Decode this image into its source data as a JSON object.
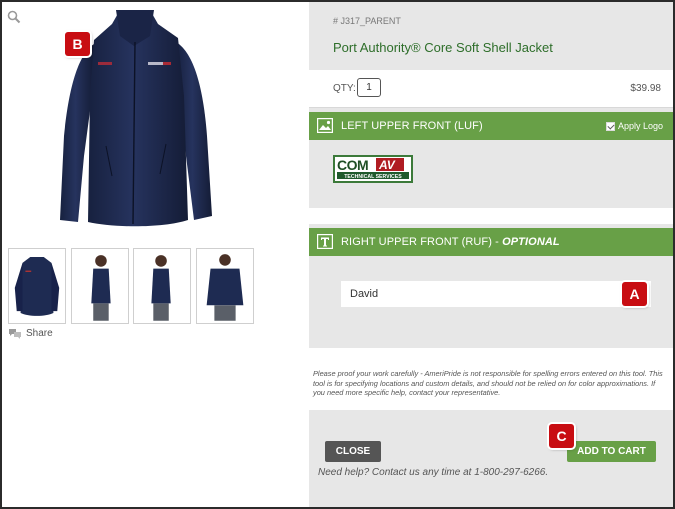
{
  "product": {
    "sku": "# J317_PARENT",
    "title": "Port Authority® Core Soft Shell Jacket",
    "qty_label": "QTY:",
    "qty_value": "1",
    "price": "$39.98"
  },
  "gallery": {
    "share_label": "Share",
    "jacket_color": "#1e2b52",
    "thumbnails": [
      "front",
      "side-left",
      "side-right",
      "back"
    ]
  },
  "locations": [
    {
      "label": "LEFT UPPER FRONT (LUF)",
      "apply_logo_label": "Apply Logo",
      "apply_logo_checked": true,
      "logo": {
        "line1": "COM",
        "line1b": "AV",
        "line2": "TECHNICAL SERVICES"
      }
    },
    {
      "label": "RIGHT UPPER FRONT (RUF) - ",
      "optional_label": "OPTIONAL",
      "input_value": "David"
    }
  ],
  "disclaimer": "Please proof your work carefully - AmeriPride is not responsible for spelling errors entered on this tool. This tool is for specifying locations and custom details, and should not be relied on for color approximations. If you need more specific help, contact your representative.",
  "actions": {
    "close_label": "CLOSE",
    "add_to_cart_label": "ADD TO CART",
    "help_text": "Need help? Contact us any time at 1-800-297-6266."
  },
  "callouts": {
    "a": "A",
    "b": "B",
    "c": "C"
  },
  "colors": {
    "accent_green": "#68a047",
    "title_green": "#2e6e2a",
    "callout_red": "#c80d12",
    "panel_gray": "#e7e7e7"
  }
}
